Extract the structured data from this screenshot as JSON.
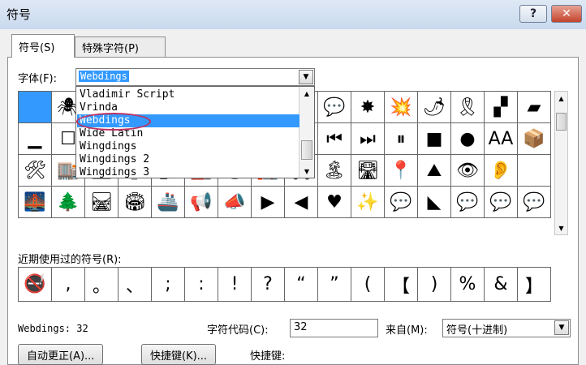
{
  "window": {
    "title": "符号",
    "help": "?",
    "close": "✕"
  },
  "tabs": [
    {
      "label": "符号(S)"
    },
    {
      "label": "特殊字符(P)"
    }
  ],
  "font_label": "字体(F):",
  "font_value": "Webdings",
  "font_list": [
    "Vladimir Script",
    "Vrinda",
    "Webdings",
    "Wide Latin",
    "Wingdings",
    "Wingdings 2",
    "Wingdings 3"
  ],
  "symbol_rows": [
    [
      "",
      "🕷",
      "",
      "",
      "",
      "",
      "",
      "",
      "",
      "💬",
      "✸",
      "💥",
      "🌶",
      "🎗",
      "▞",
      "▰"
    ],
    [
      "▁",
      "☐",
      "",
      "",
      "",
      "",
      "",
      "",
      "",
      "⏮",
      "⏭",
      "⏸",
      "■",
      "●",
      "AA",
      "📦"
    ],
    [
      "🛠",
      "🏬",
      "🏛",
      "🏠",
      "🏗",
      "🏭",
      "🏟",
      "🏣",
      "🚗",
      "🏝",
      "🛣",
      "📍",
      "⛰",
      "👁",
      "👂",
      ""
    ],
    [
      "🌉",
      "🌲",
      "🛤",
      "🏟",
      "🚢",
      "📢",
      "📣",
      "▶",
      "◀",
      "♥",
      "✨",
      "💬",
      "◣",
      "💬",
      "💬",
      "💬"
    ]
  ],
  "recent_label": "近期使用过的符号(R):",
  "recent": [
    "🚭",
    ",",
    "。",
    "、",
    ";",
    ":",
    "!",
    "?",
    "“",
    "”",
    "(",
    "【",
    ")",
    "%",
    "&",
    "】"
  ],
  "status_text": "Webdings: 32",
  "code_label": "字符代码(C):",
  "code_value": "32",
  "from_label": "来自(M):",
  "from_value": "符号(十进制)",
  "buttons": {
    "autocorrect": "自动更正(A)...",
    "shortcut_key": "快捷键(K)...",
    "shortcut_label": "快捷键:"
  }
}
